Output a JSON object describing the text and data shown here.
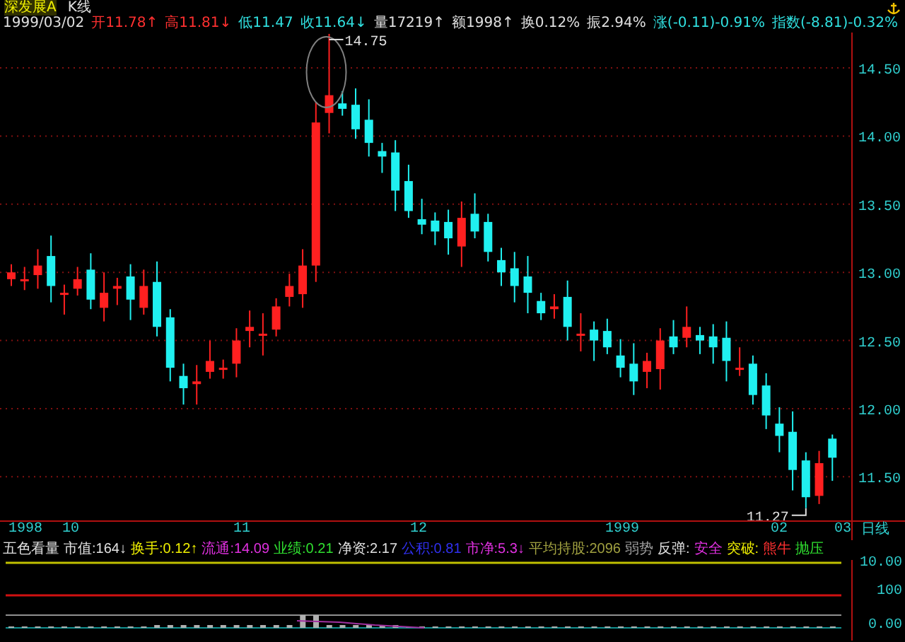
{
  "header": {
    "stock_name": "深发展A",
    "chart_type": "K线"
  },
  "quote_line": [
    {
      "text": "1999/03/02",
      "color": "#e0e0e0"
    },
    {
      "text": "开11.78↑",
      "color": "#ff3030"
    },
    {
      "text": "高11.81↓",
      "color": "#ff3030"
    },
    {
      "text": "低11.47",
      "color": "#30e0e0"
    },
    {
      "text": "收11.64↓",
      "color": "#30e0e0"
    },
    {
      "text": "量17219↑",
      "color": "#e0e0e0"
    },
    {
      "text": "额1998↑",
      "color": "#e0e0e0"
    },
    {
      "text": "换0.12%",
      "color": "#e0e0e0"
    },
    {
      "text": "振2.94%",
      "color": "#e0e0e0"
    },
    {
      "text": "涨(-0.11)-0.91%",
      "color": "#30e0e0"
    },
    {
      "text": "指数(-8.81)-0.32%",
      "color": "#30e0e0"
    }
  ],
  "price_chart": {
    "high_label": "14.75",
    "low_label": "11.27",
    "chart_data": {
      "type": "candlestick",
      "ylim": [
        11.18,
        14.76
      ],
      "grid": true,
      "yticks": [
        {
          "value": 14.5,
          "label": "14.50"
        },
        {
          "value": 14.0,
          "label": "14.00"
        },
        {
          "value": 13.5,
          "label": "13.50"
        },
        {
          "value": 13.0,
          "label": "13.00"
        },
        {
          "value": 12.5,
          "label": "12.50"
        },
        {
          "value": 12.0,
          "label": "12.00"
        },
        {
          "value": 11.5,
          "label": "11.50"
        }
      ],
      "ohlc": [
        [
          12.95,
          13.06,
          12.9,
          13.0
        ],
        [
          12.94,
          13.04,
          12.87,
          12.95
        ],
        [
          12.98,
          13.17,
          12.88,
          13.05
        ],
        [
          13.12,
          13.27,
          12.78,
          12.9
        ],
        [
          12.84,
          12.91,
          12.69,
          12.85
        ],
        [
          12.88,
          13.04,
          12.83,
          12.95
        ],
        [
          13.02,
          13.14,
          12.73,
          12.8
        ],
        [
          12.74,
          13.0,
          12.64,
          12.85
        ],
        [
          12.88,
          12.96,
          12.76,
          12.9
        ],
        [
          12.97,
          13.06,
          12.65,
          12.8
        ],
        [
          12.74,
          13.02,
          12.69,
          12.9
        ],
        [
          12.93,
          13.08,
          12.53,
          12.6
        ],
        [
          12.67,
          12.73,
          12.2,
          12.3
        ],
        [
          12.24,
          12.33,
          12.03,
          12.15
        ],
        [
          12.18,
          12.32,
          12.03,
          12.2
        ],
        [
          12.27,
          12.5,
          12.22,
          12.35
        ],
        [
          12.29,
          12.36,
          12.22,
          12.3
        ],
        [
          12.33,
          12.59,
          12.23,
          12.5
        ],
        [
          12.57,
          12.72,
          12.45,
          12.6
        ],
        [
          12.54,
          12.7,
          12.39,
          12.55
        ],
        [
          12.58,
          12.81,
          12.53,
          12.75
        ],
        [
          12.82,
          12.99,
          12.75,
          12.9
        ],
        [
          12.84,
          13.17,
          12.74,
          13.05
        ],
        [
          13.05,
          14.25,
          12.93,
          14.1
        ],
        [
          14.17,
          14.75,
          14.02,
          14.3
        ],
        [
          14.24,
          14.33,
          14.15,
          14.2
        ],
        [
          14.23,
          14.35,
          13.98,
          14.05
        ],
        [
          14.12,
          14.27,
          13.85,
          13.95
        ],
        [
          13.89,
          13.95,
          13.73,
          13.85
        ],
        [
          13.88,
          13.97,
          13.45,
          13.6
        ],
        [
          13.67,
          13.79,
          13.4,
          13.45
        ],
        [
          13.39,
          13.54,
          13.28,
          13.35
        ],
        [
          13.38,
          13.44,
          13.2,
          13.3
        ],
        [
          13.37,
          13.46,
          13.13,
          13.25
        ],
        [
          13.19,
          13.52,
          13.04,
          13.4
        ],
        [
          13.43,
          13.58,
          13.25,
          13.3
        ],
        [
          13.37,
          13.43,
          13.08,
          13.15
        ],
        [
          13.09,
          13.18,
          12.9,
          13.0
        ],
        [
          13.03,
          13.15,
          12.78,
          12.9
        ],
        [
          12.97,
          13.12,
          12.7,
          12.85
        ],
        [
          12.79,
          12.85,
          12.65,
          12.7
        ],
        [
          12.73,
          12.84,
          12.66,
          12.75
        ],
        [
          12.82,
          12.94,
          12.5,
          12.6
        ],
        [
          12.54,
          12.7,
          12.42,
          12.55
        ],
        [
          12.58,
          12.64,
          12.35,
          12.5
        ],
        [
          12.57,
          12.66,
          12.4,
          12.45
        ],
        [
          12.39,
          12.51,
          12.23,
          12.3
        ],
        [
          12.33,
          12.48,
          12.1,
          12.2
        ],
        [
          12.27,
          12.41,
          12.15,
          12.35
        ],
        [
          12.29,
          12.59,
          12.14,
          12.5
        ],
        [
          12.53,
          12.65,
          12.4,
          12.45
        ],
        [
          12.52,
          12.75,
          12.45,
          12.6
        ],
        [
          12.54,
          12.6,
          12.4,
          12.5
        ],
        [
          12.53,
          12.62,
          12.33,
          12.45
        ],
        [
          12.52,
          12.64,
          12.2,
          12.35
        ],
        [
          12.29,
          12.45,
          12.24,
          12.3
        ],
        [
          12.33,
          12.39,
          12.03,
          12.1
        ],
        [
          12.17,
          12.26,
          11.85,
          11.95
        ],
        [
          11.89,
          12.01,
          11.68,
          11.8
        ],
        [
          11.83,
          11.98,
          11.4,
          11.55
        ],
        [
          11.62,
          11.68,
          11.27,
          11.35
        ],
        [
          11.36,
          11.69,
          11.3,
          11.6
        ],
        [
          11.78,
          11.81,
          11.47,
          11.64
        ]
      ]
    }
  },
  "date_axis": {
    "labels": [
      "1998",
      "10",
      "11",
      "12",
      "1999",
      "02",
      "03"
    ],
    "period": "日线"
  },
  "indicator_bar": [
    {
      "text": "五色看量",
      "color": "#e0e0e0"
    },
    {
      "text": "市值:164↓",
      "color": "#e0e0e0"
    },
    {
      "text": "换手:0.12↑",
      "color": "#f0f000"
    },
    {
      "text": "流通:14.09",
      "color": "#e030e0"
    },
    {
      "text": "业绩:0.21",
      "color": "#30e030"
    },
    {
      "text": "净资:2.17",
      "color": "#e0e0e0"
    },
    {
      "text": "公积:0.81",
      "color": "#3030f0"
    },
    {
      "text": "市净:5.3↓",
      "color": "#e030e0"
    },
    {
      "text": "平均持股:2096",
      "color": "#a0a040"
    },
    {
      "text": "弱势",
      "color": "#a0a0a0"
    },
    {
      "text": "反弹:",
      "color": "#e0e0e0"
    },
    {
      "text": "安全",
      "color": "#e030e0"
    },
    {
      "text": "突破:",
      "color": "#f0f000"
    },
    {
      "text": "熊牛",
      "color": "#ff3030"
    },
    {
      "text": "抛压",
      "color": "#30e030"
    }
  ],
  "lower_axis": {
    "labels": [
      "10.00",
      "100",
      "0.00"
    ]
  }
}
